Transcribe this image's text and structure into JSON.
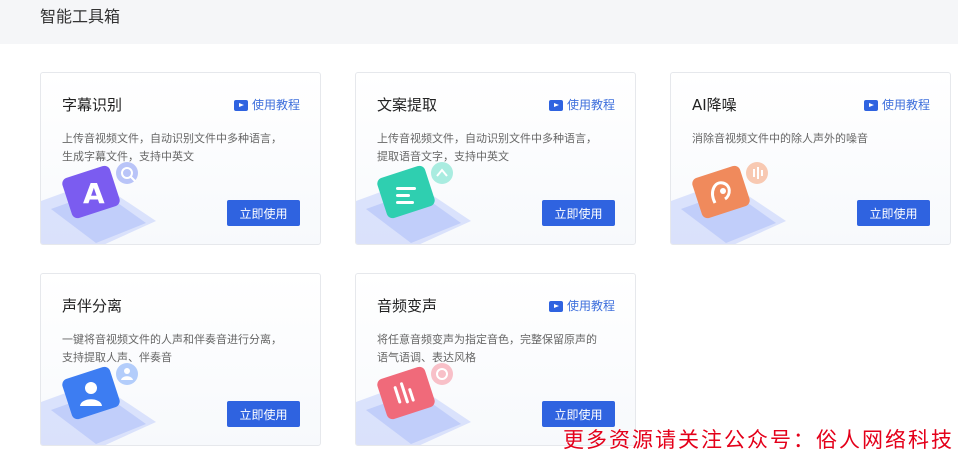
{
  "page": {
    "title": "智能工具箱"
  },
  "tools": [
    {
      "title": "字幕识别",
      "tutorial": "使用教程",
      "desc_line1": "上传音视频文件，自动识别文件中多种语言，",
      "desc_line2": "生成字幕文件，支持中英文",
      "button": "立即使用",
      "color": "#7b5cf0"
    },
    {
      "title": "文案提取",
      "tutorial": "使用教程",
      "desc_line1": "上传音视频文件，自动识别文件中多种语言，",
      "desc_line2": "提取语音文字，支持中英文",
      "button": "立即使用",
      "color": "#2fcfb0"
    },
    {
      "title": "AI降噪",
      "tutorial": "使用教程",
      "desc_line1": "消除音视频文件中的除人声外的噪音",
      "desc_line2": "",
      "button": "立即使用",
      "color": "#f08a5c"
    },
    {
      "title": "声伴分离",
      "desc_line1": "一键将音视频文件的人声和伴奏音进行分离，",
      "desc_line2": "支持提取人声、伴奏音",
      "button": "立即使用",
      "color": "#3d7df2"
    },
    {
      "title": "音频变声",
      "tutorial": "使用教程",
      "desc_line1": "将任意音频变声为指定音色，完整保留原声的",
      "desc_line2": "语气语调、表达风格",
      "button": "立即使用",
      "color": "#f06a7a"
    }
  ],
  "watermark": "更多资源请关注公众号：俗人网络科技"
}
